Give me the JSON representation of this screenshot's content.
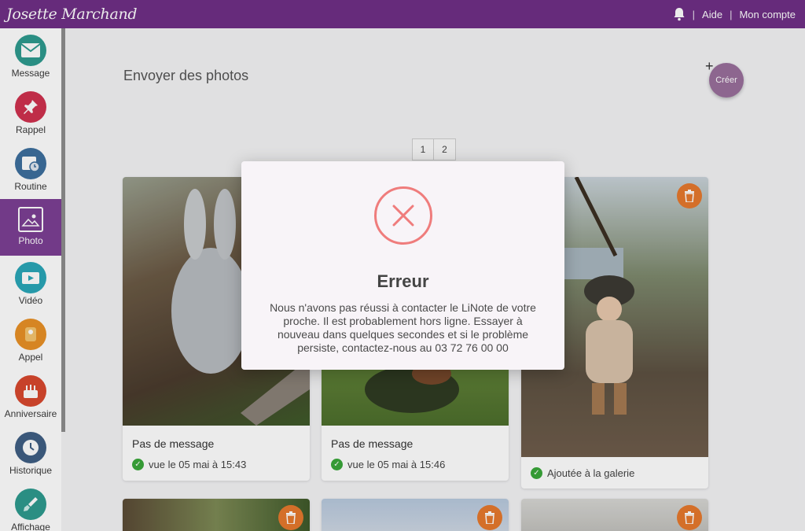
{
  "header": {
    "brand": "Josette Marchand",
    "help": "Aide",
    "account": "Mon compte",
    "bell_icon": "bell-icon"
  },
  "sidebar": {
    "items": [
      {
        "label": "Message",
        "icon": "envelope-icon",
        "color": "#2e9b8f"
      },
      {
        "label": "Rappel",
        "icon": "pin-icon",
        "color": "#d0314f"
      },
      {
        "label": "Routine",
        "icon": "calendar-clock-icon",
        "color": "#3d6f9e"
      },
      {
        "label": "Photo",
        "icon": "photo-icon",
        "color": "#7c3f94"
      },
      {
        "label": "Vidéo",
        "icon": "video-icon",
        "color": "#2aa7b8"
      },
      {
        "label": "Appel",
        "icon": "phone-icon",
        "color": "#e99126"
      },
      {
        "label": "Anniversaire",
        "icon": "cake-icon",
        "color": "#d8482e"
      },
      {
        "label": "Historique",
        "icon": "clock-icon",
        "color": "#3f5f84"
      },
      {
        "label": "Affichage",
        "icon": "brush-icon",
        "color": "#2e9b8f"
      }
    ]
  },
  "main": {
    "title": "Envoyer des photos",
    "create_label": "Créer",
    "pages": [
      "1",
      "2"
    ]
  },
  "cards": [
    {
      "message": "Pas de message",
      "status": "vue le 05 mai à 15:43"
    },
    {
      "message": "Pas de message",
      "status": "vue le 05 mai à 15:46"
    },
    {
      "message": "",
      "status": "Ajoutée à la galerie"
    }
  ],
  "modal": {
    "title": "Erreur",
    "text": "Nous n'avons pas réussi à contacter le LiNote de votre proche. Il est probablement hors ligne. Essayer à nouveau dans quelques secondes et si le problème persiste, contactez-nous au 03 72 76 00 00",
    "icon": "error-x-icon",
    "accent": "#ef7c7c"
  }
}
